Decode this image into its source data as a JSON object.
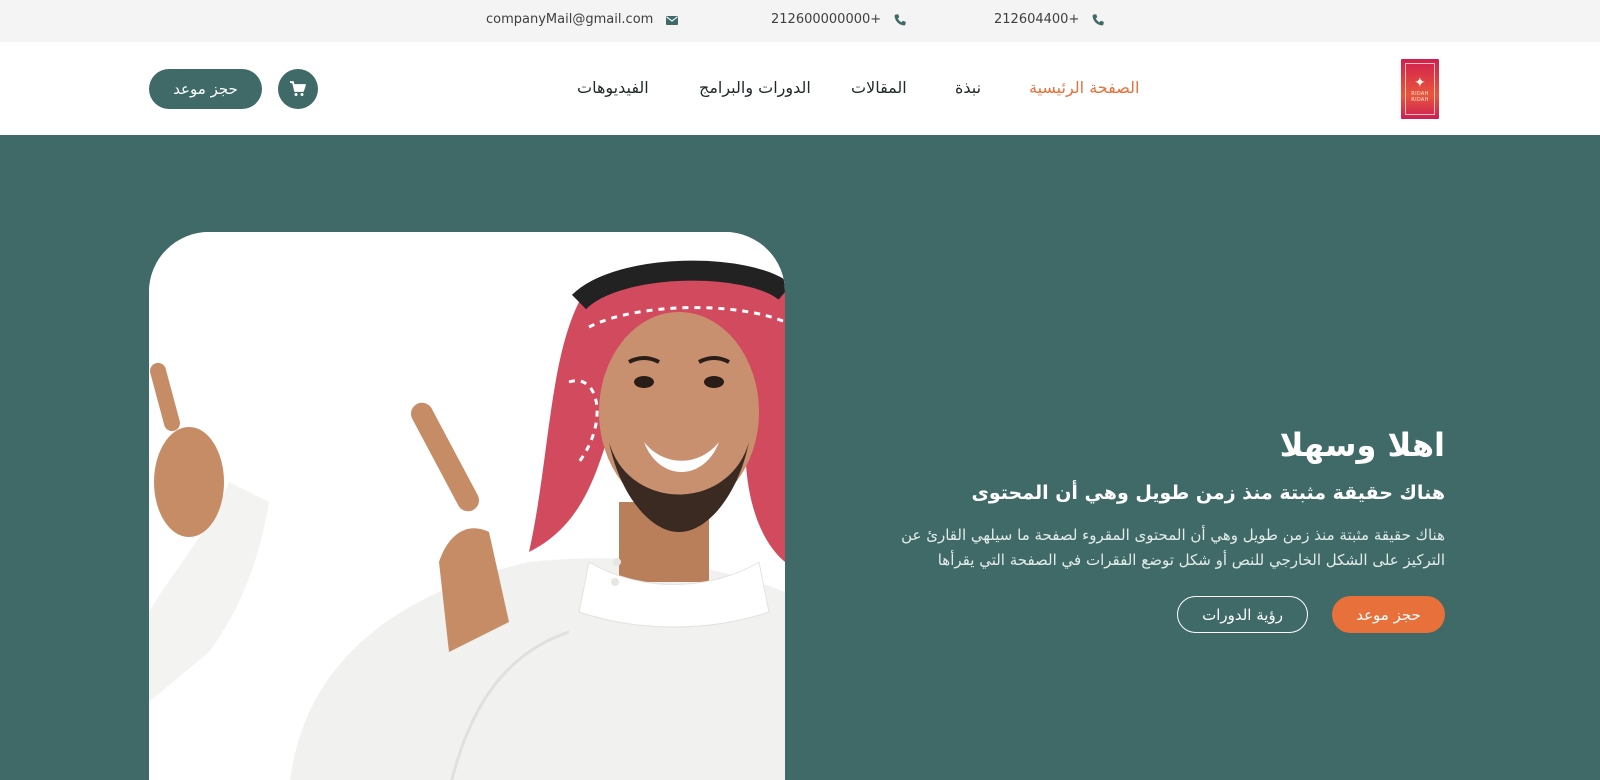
{
  "topbar": {
    "email": "companyMail@gmail.com",
    "phone1": "212600000000+",
    "phone2": "212604400+",
    "email_icon": "envelope-icon",
    "phone_icon": "phone-icon"
  },
  "navbar": {
    "logo_text_top": "RIDAH",
    "logo_text_bottom": "RIDAH",
    "links": [
      {
        "label": "الصفحة الرئيسية",
        "active": true
      },
      {
        "label": "نبذة",
        "active": false
      },
      {
        "label": "المقالات",
        "active": false
      },
      {
        "label": "الدورات والبرامج",
        "active": false
      },
      {
        "label": "الفيديوهات",
        "active": false
      }
    ],
    "cart_icon": "shopping-cart-icon",
    "book_label": "حجز موعد"
  },
  "hero": {
    "title": "اهلا وسهلا",
    "subtitle": "هناك حقيقة مثبتة منذ زمن طويل وهي أن المحتوى",
    "description_line1": "هناك حقيقة مثبتة منذ زمن طويل وهي أن المحتوى المقروء لصفحة ما سيلهي القارئ عن",
    "description_line2": "التركيز على الشكل الخارجي للنص أو شكل توضع الفقرات في الصفحة التي يقرأها",
    "primary_button": "حجز موعد",
    "secondary_button": "رؤية الدورات"
  },
  "colors": {
    "brand_green": "#3f6a67",
    "accent_orange": "#e8703a",
    "topbar_bg": "#f4f4f4"
  }
}
